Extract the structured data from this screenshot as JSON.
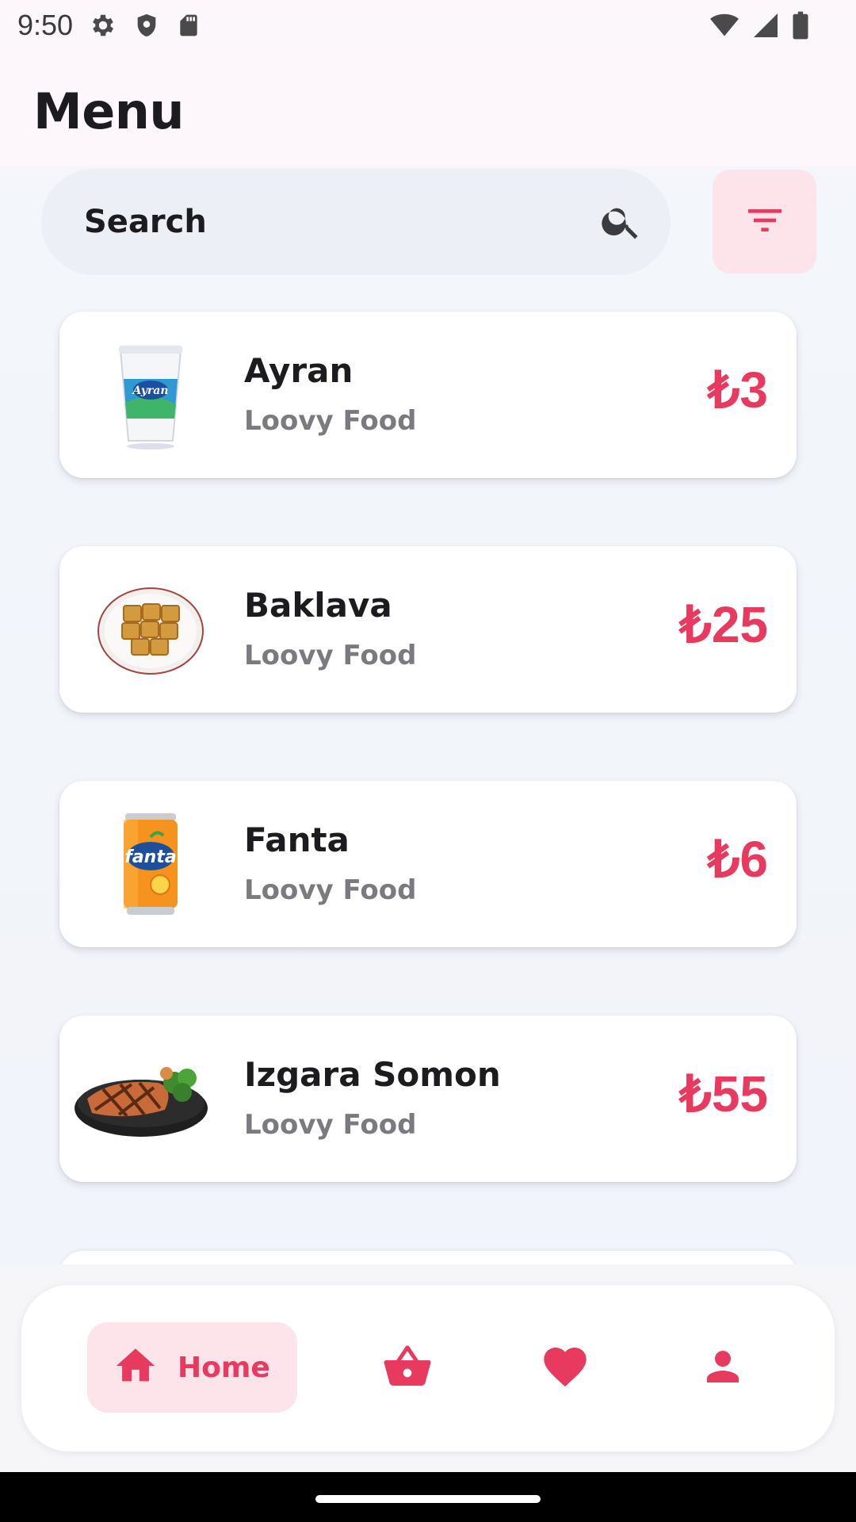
{
  "status_bar": {
    "time": "9:50",
    "left_icons": [
      "settings-icon",
      "shield-icon",
      "sd-card-icon"
    ],
    "right_icons": [
      "wifi-icon",
      "cell-signal-icon",
      "battery-icon"
    ]
  },
  "app_bar": {
    "title": "Menu"
  },
  "search": {
    "placeholder": "Search",
    "icon": "search-icon"
  },
  "filter": {
    "icon": "filter-icon"
  },
  "menu_items": [
    {
      "name": "Ayran",
      "vendor": "Loovy Food",
      "price": "₺3",
      "image": "ayran-cup"
    },
    {
      "name": "Baklava",
      "vendor": "Loovy Food",
      "price": "₺25",
      "image": "baklava-plate"
    },
    {
      "name": "Fanta",
      "vendor": "Loovy Food",
      "price": "₺6",
      "image": "fanta-can"
    },
    {
      "name": "Izgara Somon",
      "vendor": "Loovy Food",
      "price": "₺55",
      "image": "grilled-salmon"
    }
  ],
  "bottom_nav": {
    "items": [
      {
        "label": "Home",
        "icon": "home-icon",
        "selected": true
      },
      {
        "label": "",
        "icon": "basket-icon",
        "selected": false
      },
      {
        "label": "",
        "icon": "heart-icon",
        "selected": false
      },
      {
        "label": "",
        "icon": "person-icon",
        "selected": false
      }
    ]
  },
  "colors": {
    "accent": "#e8395f",
    "accent_bg": "#fde4ea",
    "text_primary": "#1c1b1f",
    "text_secondary": "#7a7a80"
  }
}
